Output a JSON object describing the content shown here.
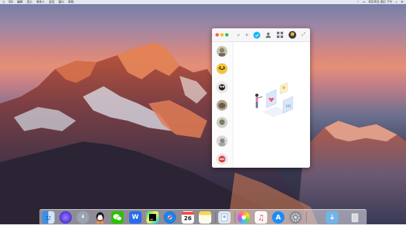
{
  "menubar": {
    "items": [
      "QQ",
      "编辑",
      "显示",
      "联系人",
      "会话",
      "窗口",
      "帮助"
    ],
    "clock": "8月26日 周日 下午"
  },
  "qq_window": {
    "contacts_count": 7
  },
  "dock": {
    "calendar_day": "26",
    "wps_label": "W"
  },
  "colors": {
    "qq_accent": "#12b7f5",
    "close": "#fe5f57",
    "minimize": "#febc2e",
    "zoom": "#28c840"
  },
  "icons": [
    "apple-icon",
    "wifi-icon",
    "battery-icon",
    "spotlight-icon",
    "siri-icon",
    "notification-icon",
    "search-icon",
    "add-icon",
    "qq-status-icon",
    "contacts-icon",
    "apps-grid-icon",
    "expand-icon",
    "finder-icon",
    "siri-icon",
    "launchpad-icon",
    "qq-icon",
    "wechat-icon",
    "wps-icon",
    "pycharm-icon",
    "safari-icon",
    "calendar-icon",
    "notes-icon",
    "preview-icon",
    "photos-icon",
    "music-icon",
    "app-store-icon",
    "system-preferences-icon",
    "downloads-folder-icon",
    "trash-icon"
  ]
}
